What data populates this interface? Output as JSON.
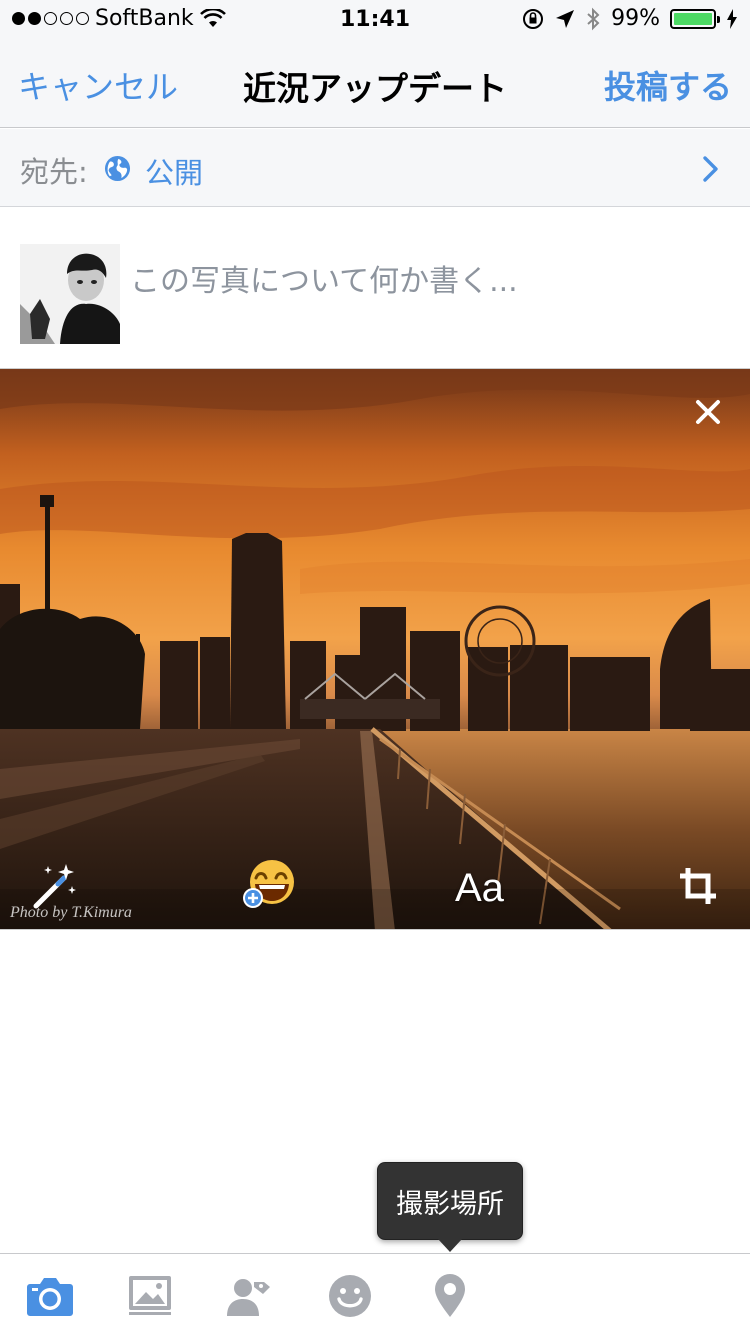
{
  "status_bar": {
    "carrier": "SoftBank",
    "time": "11:41",
    "battery_percent": "99%",
    "signal_bars_filled": 2,
    "signal_bars_total": 5
  },
  "nav": {
    "cancel_label": "キャンセル",
    "title": "近況アップデート",
    "post_label": "投稿する"
  },
  "audience": {
    "label": "宛先:",
    "value": "公開"
  },
  "composer": {
    "placeholder": "この写真について何か書く...",
    "value": ""
  },
  "photo": {
    "watermark": "Photo by T.Kimura",
    "text_tool_label": "Aa"
  },
  "tooltip": {
    "text": "撮影場所"
  },
  "toolbar": {
    "items": [
      "camera-icon",
      "photos-icon",
      "tag-people-icon",
      "feeling-icon",
      "location-pin-icon"
    ]
  },
  "colors": {
    "accent": "#4a90e2",
    "bar_background": "#f6f7f9",
    "icon_gray": "#a8abb1",
    "battery_green": "#4cd964"
  }
}
